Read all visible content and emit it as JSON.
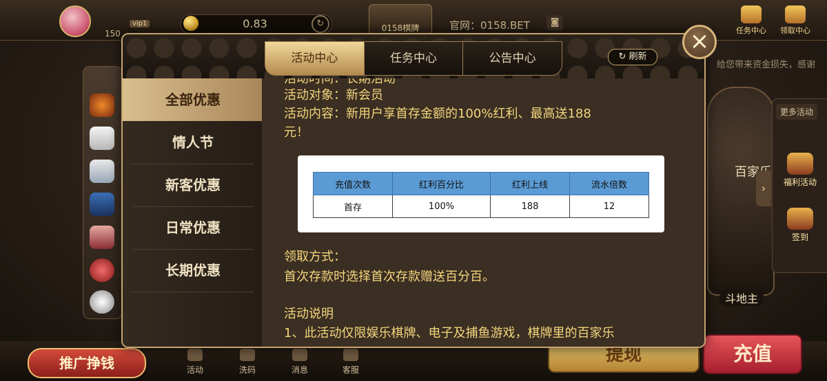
{
  "lobby": {
    "vip_badge": "vip1",
    "user_id": "150",
    "balance": "0.83",
    "logo_text": "0158棋牌",
    "website": "官网：0158.BET",
    "task_center": "任务中心",
    "claim_center": "领取中心",
    "marquee": "给您带来资金损失，感谢",
    "more_activities": "更多活动",
    "welfare": "福利活动",
    "checkin": "签到",
    "baccarat": "百家乐",
    "landlord": "斗地主",
    "promo": "推广挣钱",
    "nav": [
      "活动",
      "洗码",
      "消息",
      "客服"
    ],
    "withdraw": "提现",
    "recharge": "充值"
  },
  "modal": {
    "tabs": [
      "活动中心",
      "任务中心",
      "公告中心"
    ],
    "active_tab": 0,
    "refresh": "刷新",
    "menu": [
      "全部优惠",
      "情人节",
      "新客优惠",
      "日常优惠",
      "长期优惠"
    ],
    "content": {
      "line_partial": "活动时间：长期活动",
      "target": "活动对象：新会员",
      "desc_1": "活动内容：新用户享首存金额的100%红利、最高送188",
      "desc_2": "元！",
      "table": {
        "headers": [
          "充值次数",
          "红利百分比",
          "红利上线",
          "流水倍数"
        ],
        "rows": [
          [
            "首存",
            "100%",
            "188",
            "12"
          ]
        ]
      },
      "claim_title": "领取方式：",
      "claim_body": "首次存款时选择首次存款赠送百分百。",
      "rules_title": "活动说明",
      "rules_1": "1、此活动仅限娱乐棋牌、电子及捕鱼游戏，棋牌里的百家乐"
    }
  }
}
